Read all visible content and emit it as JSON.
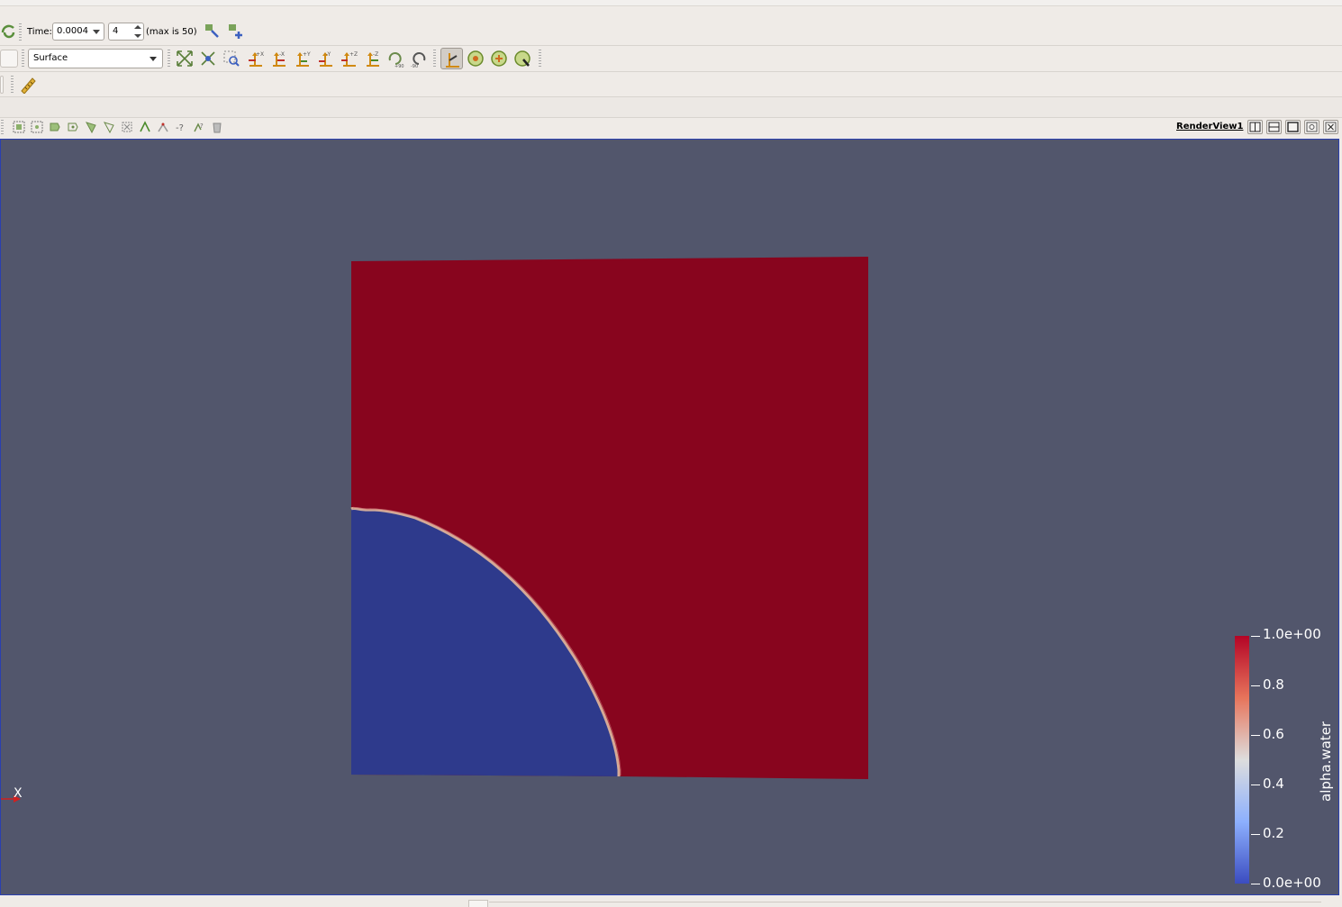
{
  "time_toolbar": {
    "time_label": "Time:",
    "time_value": "0.0004",
    "timestep_value": "4",
    "max_label": "(max is 50)"
  },
  "representation_toolbar": {
    "representation": "Surface"
  },
  "render_view": {
    "title": "RenderView1",
    "background_color": "#52566c",
    "axes_label": "X"
  },
  "scalar_bar": {
    "title": "alpha.water",
    "labels": [
      "1.0e+00",
      "0.8",
      "0.6",
      "0.4",
      "0.2",
      "0.0e+00"
    ],
    "colors": {
      "high": "#b40426",
      "mid": "#dddddd",
      "low": "#3b4cc0"
    }
  },
  "field": {
    "domain_color": "#88051e",
    "water_color": "#2e3a8c"
  },
  "icons": {
    "time_toolbar": [
      "refresh-icon",
      "time-inspector-icon",
      "animation-view-icon"
    ],
    "camera_toolbar": [
      "reset-camera-icon",
      "zoom-to-data-icon",
      "zoom-to-box-icon",
      "view-plus-x-icon",
      "view-minus-x-icon",
      "view-plus-y-icon",
      "view-minus-y-icon",
      "view-plus-z-icon",
      "view-minus-z-icon",
      "rotate-plus-90-icon",
      "rotate-minus-90-icon",
      "interaction-mode-icon",
      "show-center-icon",
      "reset-center-icon",
      "pick-center-icon"
    ],
    "view_buttons": [
      "split-horizontal-icon",
      "split-vertical-icon",
      "maximize-icon",
      "capture-icon",
      "close-icon"
    ]
  }
}
